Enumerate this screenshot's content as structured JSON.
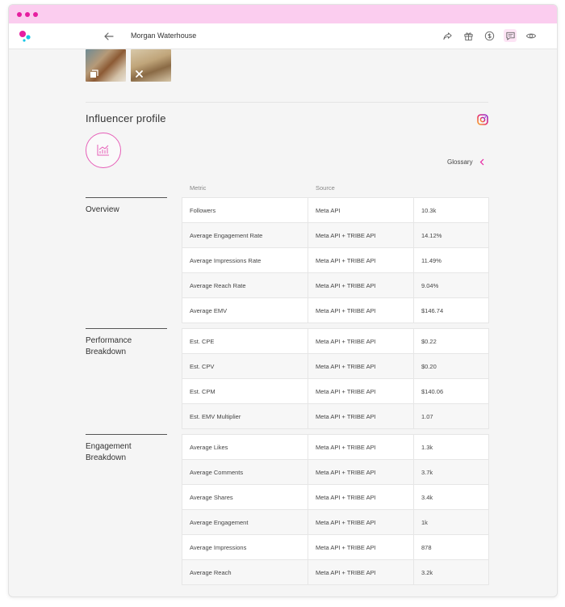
{
  "header": {
    "title": "Morgan Waterhouse",
    "actions": [
      "share-icon",
      "gift-icon",
      "dollar-icon",
      "message-icon",
      "eye-icon"
    ]
  },
  "colors": {
    "accent": "#e61ea0",
    "titlebar": "#fbcdef",
    "logo_pink": "#e61ea0",
    "logo_cyan": "#19c6e6"
  },
  "profile": {
    "title": "Influencer profile",
    "glossary_label": "Glossary"
  },
  "table": {
    "col_metric": "Metric",
    "col_source": "Source"
  },
  "sections": [
    {
      "label": "Overview",
      "rows": [
        {
          "metric": "Followers",
          "source": "Meta API",
          "value": "10.3k"
        },
        {
          "metric": "Average Engagement Rate",
          "source": "Meta API + TRIBE API",
          "value": "14.12%"
        },
        {
          "metric": "Average Impressions Rate",
          "source": "Meta API + TRIBE API",
          "value": "11.49%"
        },
        {
          "metric": "Average Reach Rate",
          "source": "Meta API + TRIBE API",
          "value": "9.04%"
        },
        {
          "metric": "Average EMV",
          "source": "Meta API + TRIBE API",
          "value": "$146.74"
        }
      ]
    },
    {
      "label": "Performance Breakdown",
      "rows": [
        {
          "metric": "Est. CPE",
          "source": "Meta API + TRIBE API",
          "value": "$0.22"
        },
        {
          "metric": "Est. CPV",
          "source": "Meta API + TRIBE API",
          "value": "$0.20"
        },
        {
          "metric": "Est. CPM",
          "source": "Meta API + TRIBE API",
          "value": "$140.06"
        },
        {
          "metric": "Est. EMV Multiplier",
          "source": "Meta API + TRIBE API",
          "value": "1.07"
        }
      ]
    },
    {
      "label": "Engagement Breakdown",
      "rows": [
        {
          "metric": "Average Likes",
          "source": "Meta API + TRIBE API",
          "value": "1.3k"
        },
        {
          "metric": "Average Comments",
          "source": "Meta API + TRIBE API",
          "value": "3.7k"
        },
        {
          "metric": "Average Shares",
          "source": "Meta API + TRIBE API",
          "value": "3.4k"
        },
        {
          "metric": "Average Engagement",
          "source": "Meta API + TRIBE API",
          "value": "1k"
        },
        {
          "metric": "Average Impressions",
          "source": "Meta API + TRIBE API",
          "value": "878"
        },
        {
          "metric": "Average Reach",
          "source": "Meta API + TRIBE API",
          "value": "3.2k"
        }
      ]
    }
  ]
}
